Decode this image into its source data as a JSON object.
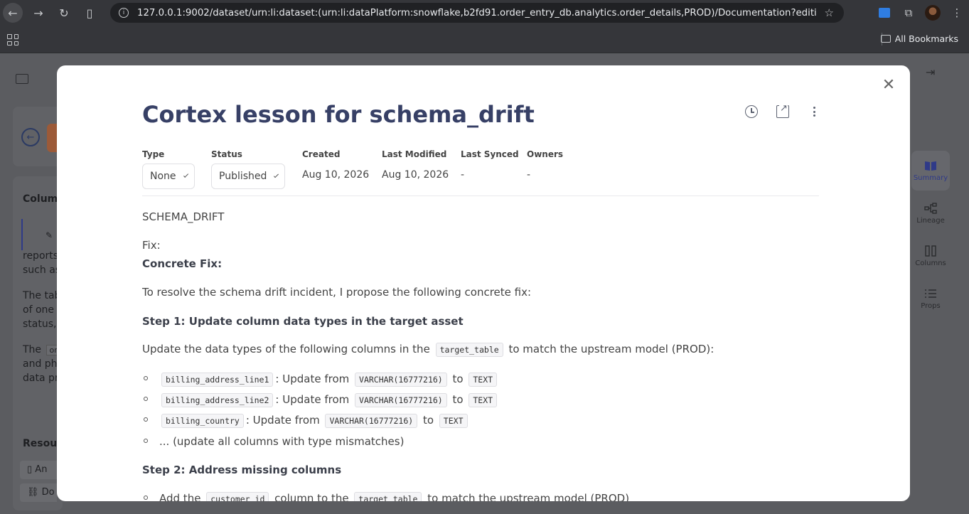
{
  "browser": {
    "url": "127.0.0.1:9002/dataset/urn:li:dataset:(urn:li:dataPlatform:snowflake,b2fd91.order_entry_db.analytics.order_details,PROD)/Documentation?editing=false&h...",
    "bookmarks_label": "All Bookmarks"
  },
  "background": {
    "columns_heading": "Column",
    "text_lines": [
      "reports,",
      "such as",
      "The tab",
      "of one r",
      "status, ",
      "The",
      "and pho",
      "data pr"
    ],
    "resources_heading": "Resour",
    "resource_items": [
      "An",
      "Do"
    ],
    "rail": [
      {
        "label": "Summary",
        "active": true
      },
      {
        "label": "Lineage",
        "active": false
      },
      {
        "label": "Columns",
        "active": false
      },
      {
        "label": "Props",
        "active": false
      }
    ]
  },
  "modal": {
    "title": "Cortex lesson for schema_drift",
    "meta": {
      "type_label": "Type",
      "type_value": "None",
      "status_label": "Status",
      "status_value": "Published",
      "created_label": "Created",
      "created_value": "Aug 10, 2026",
      "modified_label": "Last Modified",
      "modified_value": "Aug 10, 2026",
      "synced_label": "Last Synced",
      "synced_value": "-",
      "owners_label": "Owners",
      "owners_value": "-"
    },
    "content": {
      "heading_token": "SCHEMA_DRIFT",
      "fix_label": "Fix:",
      "concrete_fix": "Concrete Fix:",
      "intro": "To resolve the schema drift incident, I propose the following concrete fix:",
      "step1_title": "Step 1: Update column data types in the target asset",
      "step1_pre": "Update the data types of the following columns in the",
      "step1_code": "target_table",
      "step1_post": "to match the upstream model (PROD):",
      "bullets": [
        {
          "col": "billing_address_line1",
          "mid": ": Update from",
          "from": "VARCHAR(16777216)",
          "to_word": "to",
          "to": "TEXT"
        },
        {
          "col": "billing_address_line2",
          "mid": ": Update from",
          "from": "VARCHAR(16777216)",
          "to_word": "to",
          "to": "TEXT"
        },
        {
          "col": "billing_country",
          "mid": ": Update from",
          "from": "VARCHAR(16777216)",
          "to_word": "to",
          "to": "TEXT"
        }
      ],
      "bullet_more": "... (update all columns with type mismatches)",
      "step2_title": "Step 2: Address missing columns",
      "step2_pre": "Add the",
      "step2_code1": "customer_id",
      "step2_mid": "column to the",
      "step2_code2": "target_table",
      "step2_post": "to match the upstream model (PROD)"
    }
  }
}
